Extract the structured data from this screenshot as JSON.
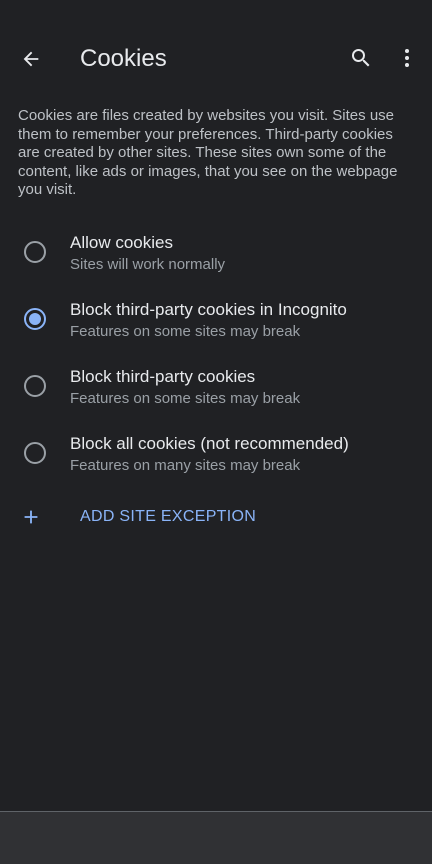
{
  "header": {
    "title": "Cookies",
    "back_icon": "arrow-back-icon",
    "search_icon": "search-icon",
    "more_icon": "more-vert-icon"
  },
  "description": "Cookies are files created by websites you visit. Sites use them to remember your preferences. Third-party cookies are created by other sites. These sites own some of the content, like ads or images, that you see on the webpage you visit.",
  "options": [
    {
      "title": "Allow cookies",
      "subtitle": "Sites will work normally",
      "selected": false
    },
    {
      "title": "Block third-party cookies in Incognito",
      "subtitle": "Features on some sites may break",
      "selected": true
    },
    {
      "title": "Block third-party cookies",
      "subtitle": "Features on some sites may break",
      "selected": false
    },
    {
      "title": "Block all cookies (not recommended)",
      "subtitle": "Features on many sites may break",
      "selected": false
    }
  ],
  "add_exception": {
    "label": "ADD SITE EXCEPTION",
    "icon": "plus-icon"
  },
  "colors": {
    "background": "#202124",
    "accent": "#8ab4f8",
    "text_primary": "#e8eaed",
    "text_secondary": "#9aa0a6",
    "bottom_bar": "#303134"
  }
}
